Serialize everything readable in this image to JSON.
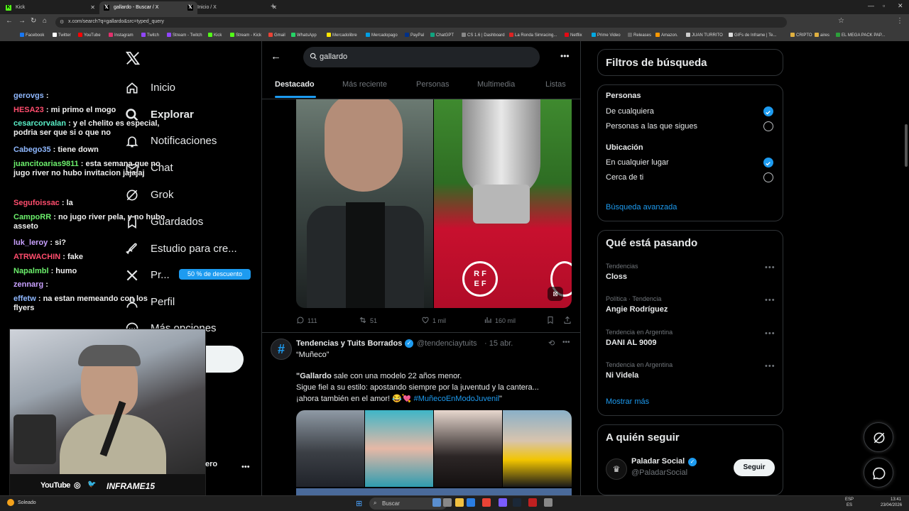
{
  "browser": {
    "tabs": [
      {
        "title": "Kick",
        "active": false
      },
      {
        "title": "gallardo - Buscar / X",
        "active": true
      },
      {
        "title": "Inicio / X",
        "active": false
      }
    ],
    "url": "x.com/search?q=gallardo&src=typed_query",
    "bookmarks": [
      "Facebook",
      "Twitter",
      "YouTube",
      "Instagram",
      "Twitch",
      "Stream - Twitch",
      "Kick",
      "Stream - Kick",
      "Gmail",
      "WhatsApp",
      "Mercadolibre",
      "Mercadopago",
      "PayPal",
      "ChatGPT",
      "CS 1.6 | Dashboard",
      "La Ronda Simracing...",
      "Netflix",
      "Prime Video",
      "Releases",
      "Amazon.",
      "JUAN TURRITO",
      "GIFs de Inframe | Te...",
      "CRIPTO",
      "aires",
      "EL MEGA PACK PAP..."
    ]
  },
  "sidebar": {
    "items": [
      {
        "label": "Inicio"
      },
      {
        "label": "Explorar"
      },
      {
        "label": "Notificaciones"
      },
      {
        "label": "Chat"
      },
      {
        "label": "Grok"
      },
      {
        "label": "Guardados"
      },
      {
        "label": "Estudio para cre..."
      },
      {
        "label": "Pr..."
      },
      {
        "label": "Perfil"
      },
      {
        "label": "Más opciones"
      }
    ],
    "premium_badge": "50 % de descuento",
    "profile_partial": "ero"
  },
  "stream_chat": [
    {
      "user": "gerovgs",
      "color": "#8fb8ff",
      "msg": ":"
    },
    {
      "user": "HESA23",
      "color": "#ff4d6d",
      "msg": ": mi primo el mogo"
    },
    {
      "user": "cesarcorvalan",
      "color": "#5af0c8",
      "msg": ": y el chelito es especial, podria ser que si o que no"
    },
    {
      "user": "Cabego35",
      "color": "#8fb8ff",
      "msg": ": tiene down"
    },
    {
      "user": "juancitoarias9811",
      "color": "#6cf06c",
      "msg": ": esta semana que no jugo river no hubo invitacion jajajaj"
    },
    {
      "user": "Segufoissac",
      "color": "#ff4d6d",
      "msg": ": la"
    },
    {
      "user": "CampoRR",
      "color": "#6cf06c",
      "msg": ": no jugo river pela, y no hubo asseto"
    },
    {
      "user": "luk_leroy",
      "color": "#c8a0ff",
      "msg": ": si?"
    },
    {
      "user": "ATRWACHIN",
      "color": "#ff4d6d",
      "msg": ": fake"
    },
    {
      "user": "Napalmbl",
      "color": "#6cf06c",
      "msg": ": humo"
    },
    {
      "user": "zennarg",
      "color": "#c8a0ff",
      "msg": ":"
    },
    {
      "user": "effetw",
      "color": "#8fb8ff",
      "msg": ": na estan memeando con los flyers"
    }
  ],
  "cam_bar": {
    "youtube": "YouTube",
    "handle": "INFRAME15"
  },
  "search": {
    "query": "gallardo",
    "tabs": [
      "Destacado",
      "Más reciente",
      "Personas",
      "Multimedia",
      "Listas"
    ]
  },
  "tweet1": {
    "replies": "111",
    "reposts": "51",
    "likes": "1 mil",
    "views": "160 mil"
  },
  "tweet2": {
    "author": "Tendencias y Tuits Borrados",
    "handle": "@tendenciaytuits",
    "date": "· 15 abr.",
    "line1": "“Muñeco”",
    "line2_bold": "\"Gallardo",
    "line2": " sale con una modelo 22 años menor.",
    "line3": "Sigue fiel a su estilo: apostando siempre por la juventud y la cantera...",
    "line4": "¡ahora también en el amor! 😂💘 ",
    "hashtag": "#MuñecoEnModoJuvenil",
    "line4_end": "\""
  },
  "filters": {
    "title": "Filtros de búsqueda",
    "people_title": "Personas",
    "people_opts": [
      "De cualquiera",
      "Personas a las que sigues"
    ],
    "location_title": "Ubicación",
    "location_opts": [
      "En cualquier lugar",
      "Cerca de ti"
    ],
    "advanced": "Búsqueda avanzada"
  },
  "trends": {
    "title": "Qué está pasando",
    "items": [
      {
        "context": "Tendencias",
        "name": "Closs"
      },
      {
        "context": "Política · Tendencia",
        "name": "Angie Rodríguez"
      },
      {
        "context": "Tendencia en Argentina",
        "name": "DANI AL 9009"
      },
      {
        "context": "Tendencia en Argentina",
        "name": "Ni Videla"
      }
    ],
    "more": "Mostrar más"
  },
  "follow": {
    "title": "A quién seguir",
    "name": "Paladar Social",
    "handle": "@PaladarSocial",
    "button": "Seguir"
  },
  "taskbar": {
    "weather": "Soleado",
    "search": "Buscar",
    "lang1": "ESP",
    "lang2": "ES",
    "time": "13:41",
    "date": "23/04/2026"
  },
  "colors": {
    "accent": "#1d9bf0",
    "bg": "#000000",
    "border": "#2f3336",
    "muted": "#71767b"
  }
}
